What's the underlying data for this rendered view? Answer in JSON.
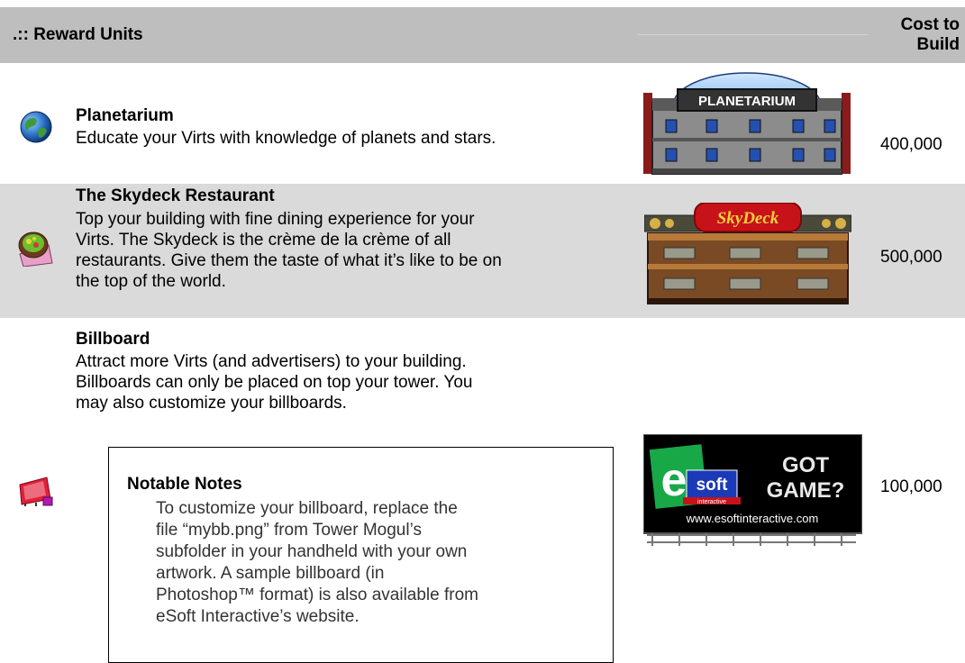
{
  "header": {
    "title": ".:: Reward Units",
    "cost_label_line1": "Cost to",
    "cost_label_line2": "Build"
  },
  "units": [
    {
      "name": "Planetarium",
      "icon": "globe-icon",
      "description": "Educate your Virts with knowledge of planets and stars.",
      "sign_text": "PLANETARIUM",
      "cost": "400,000"
    },
    {
      "name": "The Skydeck Restaurant",
      "icon": "food-plate-icon",
      "description_lines": [
        "Top your building with fine dining experience for your",
        "Virts.  The Skydeck is the crème de la crème of all",
        "restaurants.  Give them the taste of what it’s like to be on",
        "the top of the world."
      ],
      "sign_text": "SkyDeck",
      "cost": "500,000"
    },
    {
      "name": "Billboard",
      "icon": "billboard-icon",
      "description_lines": [
        "Attract more Virts (and advertisers) to your building.",
        "Billboards can only be placed on top your tower.  You",
        "may also customize your billboards."
      ],
      "billboard": {
        "logo_letter": "e",
        "logo_word": "soft",
        "logo_sub": "interactive",
        "slogan_line1": "GOT",
        "slogan_line2": "GAME?",
        "url": "www.esoftinteractive.com"
      },
      "cost": "100,000"
    }
  ],
  "notes": {
    "title": "Notable Notes",
    "lines": [
      "To customize your billboard, replace the",
      "file “mybb.png” from Tower Mogul’s",
      "subfolder in your handheld with your own",
      "artwork.  A sample billboard (in",
      "Photoshop™ format) is also available from",
      "eSoft Interactive’s website."
    ]
  },
  "colors": {
    "header_bg": "#bebebe",
    "row_alt_bg": "#dadada"
  }
}
